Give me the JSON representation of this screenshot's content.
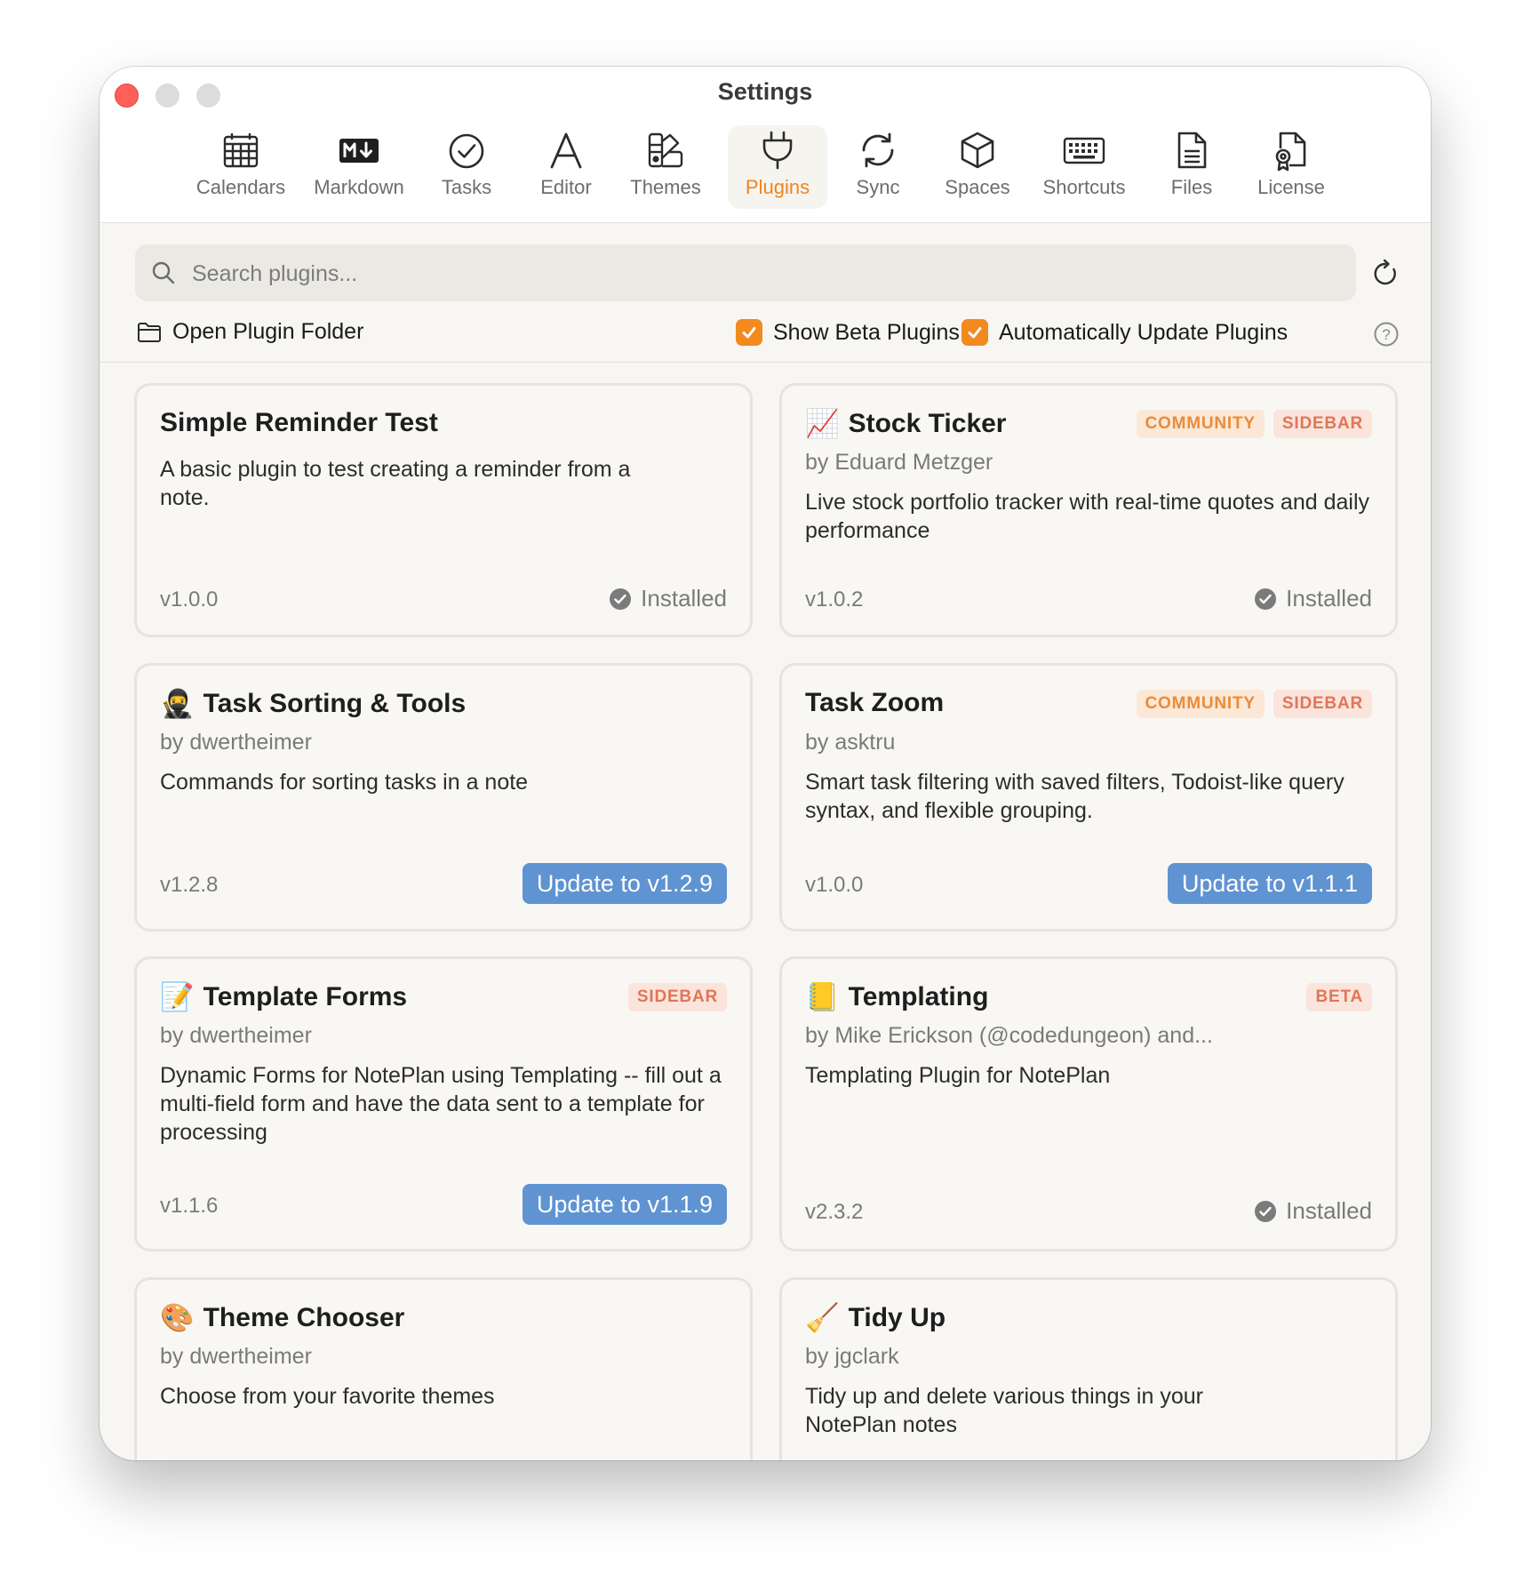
{
  "window": {
    "title": "Settings"
  },
  "tabs": [
    {
      "label": "Calendars",
      "icon": "calendar-icon"
    },
    {
      "label": "Markdown",
      "icon": "markdown-icon"
    },
    {
      "label": "Tasks",
      "icon": "checkmark-circle-icon"
    },
    {
      "label": "Editor",
      "icon": "font-a-icon"
    },
    {
      "label": "Themes",
      "icon": "palette-icon"
    },
    {
      "label": "Plugins",
      "icon": "plug-icon",
      "active": true
    },
    {
      "label": "Sync",
      "icon": "sync-arrows-icon"
    },
    {
      "label": "Spaces",
      "icon": "cube-icon"
    },
    {
      "label": "Shortcuts",
      "icon": "keyboard-icon"
    },
    {
      "label": "Files",
      "icon": "document-icon"
    },
    {
      "label": "License",
      "icon": "license-badge-icon"
    }
  ],
  "search": {
    "placeholder": "Search plugins...",
    "value": ""
  },
  "toolbar": {
    "open_folder_label": "Open Plugin Folder",
    "show_beta_label": "Show Beta Plugins",
    "show_beta_checked": true,
    "auto_update_label": "Automatically Update Plugins",
    "auto_update_checked": true
  },
  "colors": {
    "accent": "#f0831d",
    "update_button": "#5f93d2",
    "checkbox": "#f28a1f"
  },
  "plugins": [
    {
      "name": "Simple Reminder Test",
      "emoji": "",
      "author": "",
      "description": "A basic plugin to test creating a reminder from a note.",
      "version": "v1.0.0",
      "status": "Installed",
      "badges": []
    },
    {
      "name": "Stock Ticker",
      "emoji": "📈",
      "author": "by Eduard Metzger",
      "description": "Live stock portfolio tracker with real-time quotes and daily performance",
      "version": "v1.0.2",
      "status": "Installed",
      "badges": [
        "COMMUNITY",
        "SIDEBAR"
      ]
    },
    {
      "name": "Task Sorting & Tools",
      "emoji": "🥷",
      "author": "by dwertheimer",
      "description": "Commands for sorting tasks in a note",
      "version": "v1.2.8",
      "update_label": "Update to v1.2.9",
      "badges": []
    },
    {
      "name": "Task Zoom",
      "emoji": "",
      "author": "by asktru",
      "description": "Smart task filtering with saved filters, Todoist-like query syntax, and flexible grouping.",
      "version": "v1.0.0",
      "update_label": "Update to v1.1.1",
      "badges": [
        "COMMUNITY",
        "SIDEBAR"
      ]
    },
    {
      "name": "Template Forms",
      "emoji": "📝",
      "author": "by dwertheimer",
      "description": "Dynamic Forms for NotePlan using Templating -- fill out a multi-field form and have the data sent to a template for processing",
      "version": "v1.1.6",
      "update_label": "Update to v1.1.9",
      "badges": [
        "SIDEBAR"
      ]
    },
    {
      "name": "Templating",
      "emoji": "📒",
      "author": "by Mike Erickson (@codedungeon) and...",
      "description": "Templating Plugin for NotePlan",
      "version": "v2.3.2",
      "status": "Installed",
      "badges": [
        "BETA"
      ]
    },
    {
      "name": "Theme Chooser",
      "emoji": "🎨",
      "author": "by dwertheimer",
      "description": "Choose from your favorite themes",
      "badges": []
    },
    {
      "name": "Tidy Up",
      "emoji": "🧹",
      "author": "by jgclark",
      "description": "Tidy up and delete various things in your NotePlan notes",
      "badges": []
    }
  ]
}
